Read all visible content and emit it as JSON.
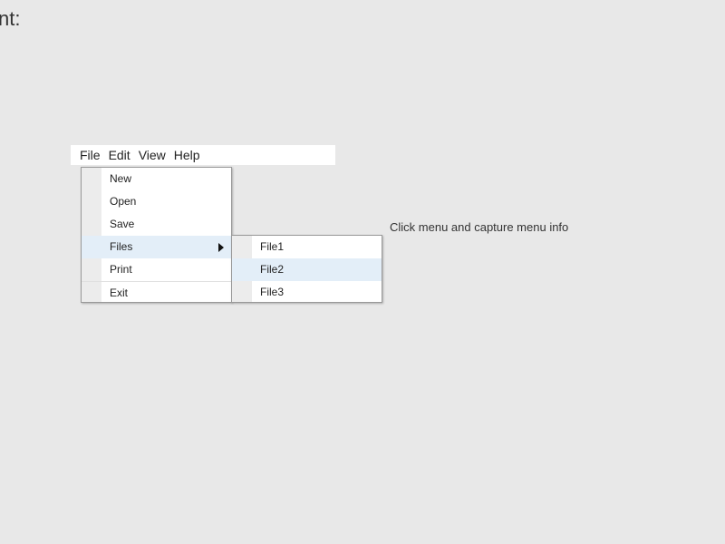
{
  "header": {
    "text": "nt:"
  },
  "menubar": {
    "items": [
      {
        "label": "File"
      },
      {
        "label": "Edit"
      },
      {
        "label": "View"
      },
      {
        "label": "Help"
      }
    ]
  },
  "file_menu": {
    "items": [
      {
        "label": "New"
      },
      {
        "label": "Open"
      },
      {
        "label": "Save"
      },
      {
        "label": "Files"
      },
      {
        "label": "Print"
      },
      {
        "label": "Exit"
      }
    ]
  },
  "files_submenu": {
    "items": [
      {
        "label": "File1"
      },
      {
        "label": "File2"
      },
      {
        "label": "File3"
      }
    ]
  },
  "hint": {
    "text": "Click menu and capture menu info"
  },
  "colors": {
    "background": "#e8e8e8",
    "highlight": "#e3eef8"
  }
}
